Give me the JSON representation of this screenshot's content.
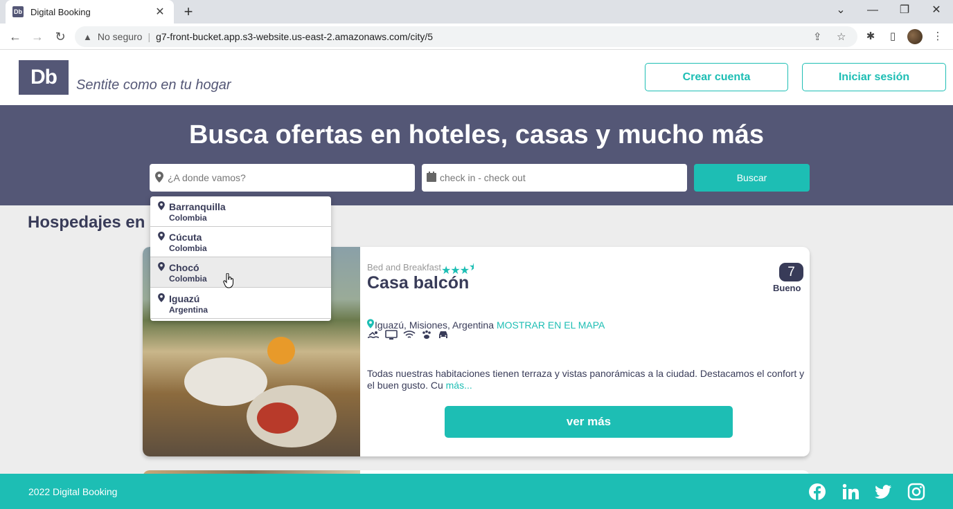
{
  "browser": {
    "tab_title": "Digital Booking",
    "tab_favicon": "Db",
    "insecure_label": "No seguro",
    "url": "g7-front-bucket.app.s3-website.us-east-2.amazonaws.com/city/5"
  },
  "header": {
    "logo_text": "Db",
    "tagline": "Sentite como en tu hogar",
    "create_account": "Crear cuenta",
    "login": "Iniciar sesión"
  },
  "search": {
    "title": "Busca ofertas en hoteles, casas y mucho más",
    "destination_placeholder": "¿A donde vamos?",
    "dates_placeholder": "check in - check out",
    "button": "Buscar"
  },
  "dropdown": [
    {
      "city": "Barranquilla",
      "country": "Colombia"
    },
    {
      "city": "Cúcuta",
      "country": "Colombia"
    },
    {
      "city": "Chocó",
      "country": "Colombia"
    },
    {
      "city": "Iguazú",
      "country": "Argentina"
    }
  ],
  "section_title": "Hospedajes en Ig",
  "card": {
    "category": "Bed and Breakfast",
    "stars": 3.5,
    "title": "Casa balcón",
    "score": "7",
    "rating_word": "Bueno",
    "location": "Iguazú, Misiones, Argentina",
    "map_link": "MOSTRAR EN EL MAPA",
    "amenities": [
      "pool-icon",
      "tv-icon",
      "wifi-icon",
      "pets-icon",
      "car-icon"
    ],
    "description": "Todas nuestras habitaciones tienen terraza y vistas panorámicas a la ciudad. Destacamos el confort y el buen gusto. Cu ",
    "more_link": "más...",
    "button": "ver más"
  },
  "footer": {
    "copyright": "2022 Digital Booking",
    "social": [
      "facebook-icon",
      "linkedin-icon",
      "twitter-icon",
      "instagram-icon"
    ]
  },
  "colors": {
    "primary": "#1dbeb4",
    "dark": "#545776",
    "text": "#383b58"
  }
}
